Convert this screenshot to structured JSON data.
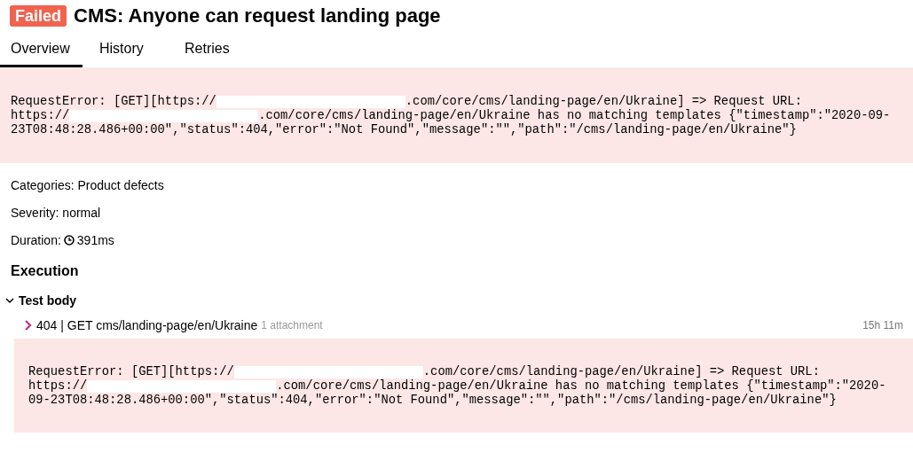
{
  "status_badge": "Failed",
  "title": "CMS: Anyone can request landing page",
  "tabs": [
    {
      "label": "Overview",
      "selected": true
    },
    {
      "label": "History",
      "selected": false
    },
    {
      "label": "Retries",
      "selected": false
    }
  ],
  "error_message": {
    "lines": [
      [
        {
          "kind": "text",
          "text": "RequestError: [GET][https://"
        },
        {
          "kind": "redacted"
        },
        {
          "kind": "text",
          "text": ".com/core/cms/landing-page/en/Ukraine] => Request URL:"
        }
      ],
      [
        {
          "kind": "text",
          "text": "https://"
        },
        {
          "kind": "redacted"
        },
        {
          "kind": "text",
          "text": ".com/core/cms/landing-page/en/Ukraine has no matching templates {\"timestamp\":\"2020-09-"
        }
      ],
      [
        {
          "kind": "text",
          "text": "23T08:48:28.486+00:00\",\"status\":404,\"error\":\"Not Found\",\"message\":\"\",\"path\":\"/cms/landing-page/en/Ukraine\"}"
        }
      ]
    ]
  },
  "details": [
    {
      "kind": "plain",
      "text": "Categories: Product defects"
    },
    {
      "kind": "plain",
      "text": "Severity: normal"
    },
    {
      "kind": "duration",
      "label": "Duration:",
      "value": "391ms"
    }
  ],
  "execution": {
    "heading": "Execution",
    "section": {
      "label": "Test body",
      "expanded": true,
      "steps": [
        {
          "label": "404 | GET cms/landing-page/en/Ukraine",
          "attachments": "1 attachment",
          "time": "15h 11m",
          "expanded": false,
          "error_message": {
            "lines": [
              [
                {
                  "kind": "text",
                  "text": "RequestError: [GET][https://"
                },
                {
                  "kind": "redacted"
                },
                {
                  "kind": "text",
                  "text": ".com/core/cms/landing-page/en/Ukraine] => Request URL:"
                }
              ],
              [
                {
                  "kind": "text",
                  "text": "https://"
                },
                {
                  "kind": "redacted"
                },
                {
                  "kind": "text",
                  "text": ".com/core/cms/landing-page/en/Ukraine has no matching templates {\"timestamp\":\"2020-"
                }
              ],
              [
                {
                  "kind": "text",
                  "text": "09-23T08:48:28.486+00:00\",\"status\":404,\"error\":\"Not Found\",\"message\":\"\",\"path\":\"/cms/landing-page/en/Ukraine\"}"
                }
              ]
            ]
          }
        }
      ]
    }
  }
}
